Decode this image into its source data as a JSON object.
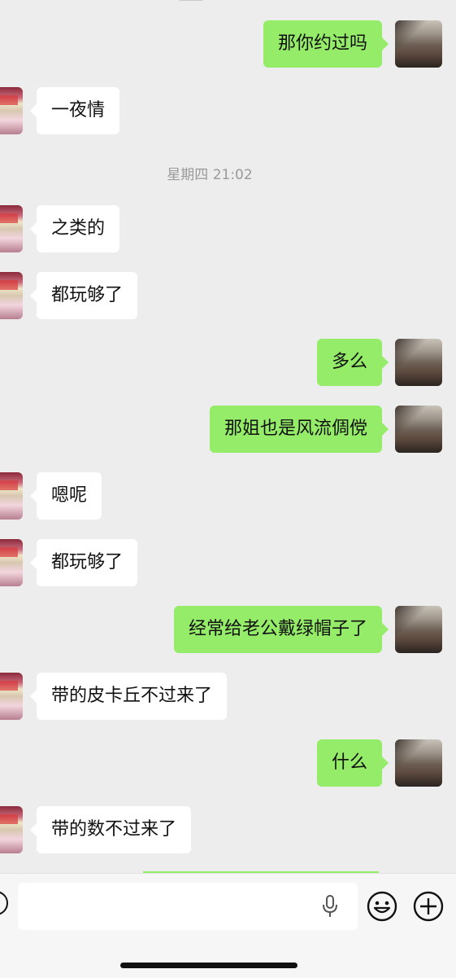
{
  "chat": {
    "timestamp": "星期四 21:02",
    "messages": [
      {
        "side": "right",
        "text": "那你约过吗"
      },
      {
        "side": "left",
        "text": "一夜情"
      },
      {
        "side": "left",
        "text": "之类的"
      },
      {
        "side": "left",
        "text": "都玩够了"
      },
      {
        "side": "right",
        "text": "多么"
      },
      {
        "side": "right",
        "text": "那姐也是风流倜傥"
      },
      {
        "side": "left",
        "text": "嗯呢"
      },
      {
        "side": "left",
        "text": "都玩够了"
      },
      {
        "side": "right",
        "text": "经常给老公戴绿帽子了"
      },
      {
        "side": "left",
        "text": "带的皮卡丘不过来了"
      },
      {
        "side": "right",
        "text": "什么"
      },
      {
        "side": "left",
        "text": "带的数不过来了"
      }
    ]
  },
  "colors": {
    "background": "#ededed",
    "sent_bubble": "#95ec69",
    "received_bubble": "#ffffff",
    "timestamp_text": "#9a9a9a"
  },
  "input_bar": {
    "voice_icon": "voice-toggle-icon",
    "mic_icon": "microphone-icon",
    "emoji_icon": "emoji-icon",
    "plus_icon": "plus-icon"
  }
}
